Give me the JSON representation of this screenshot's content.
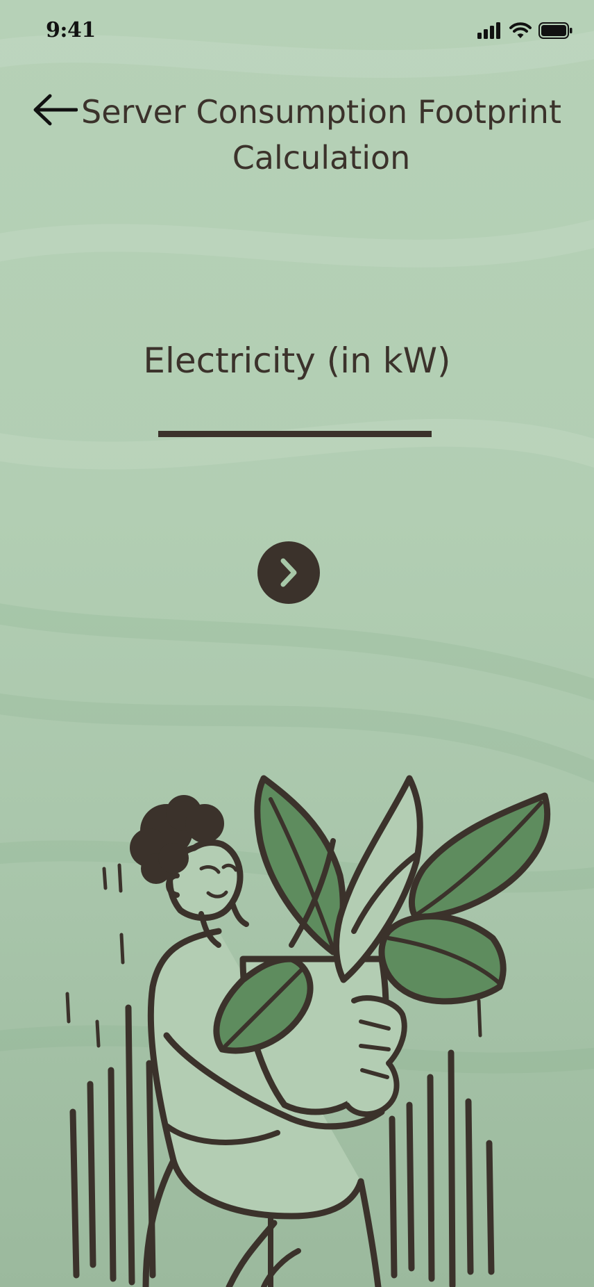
{
  "status_bar": {
    "time": "9:41",
    "icons": [
      "cellular-signal-icon",
      "wifi-icon",
      "battery-icon"
    ]
  },
  "header": {
    "back_icon": "arrow-left-icon",
    "title": "Server Consumption Footprint Calculation"
  },
  "form": {
    "field_label": "Electricity (in kW)",
    "input_value": "",
    "input_placeholder": "",
    "next_icon": "chevron-right-icon"
  },
  "illustration": {
    "subject": "person-holding-plant-illustration"
  },
  "colors": {
    "background": "#b4cfb5",
    "ink": "#3b322b",
    "leaf_green": "#5e8c5e",
    "chevron": "#a7c8a8"
  }
}
